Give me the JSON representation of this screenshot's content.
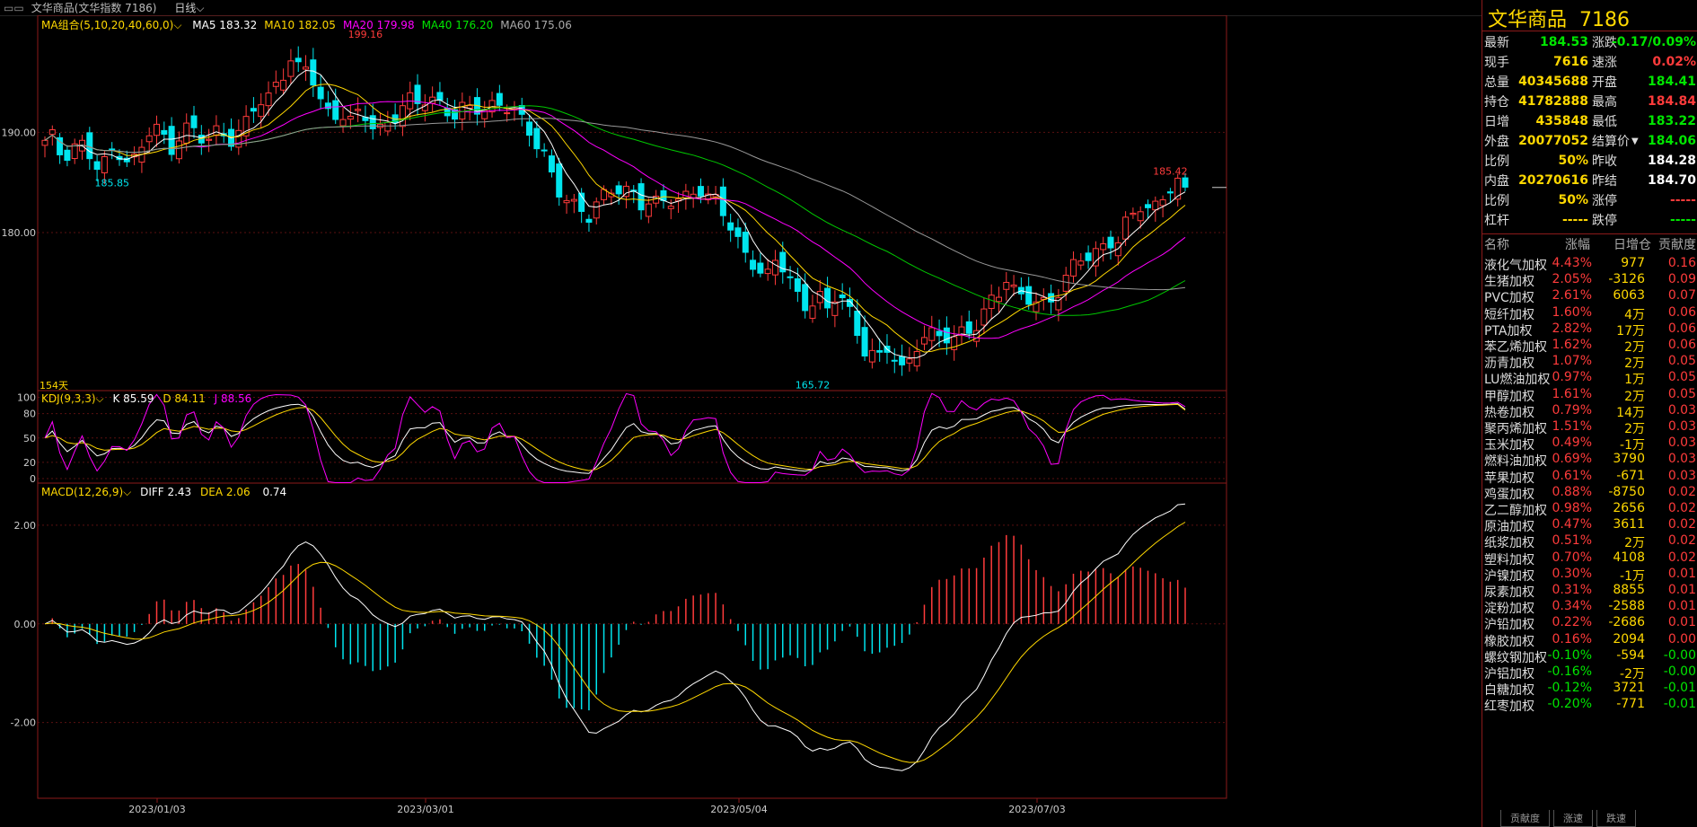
{
  "topbar": {
    "title": "文华商品(文华指数 7186)",
    "period": "日线"
  },
  "main": {
    "ma_title": "MA组合(5,10,20,40,60,0)",
    "ma": [
      {
        "label": "MA5 183.32",
        "color": "#ffffff"
      },
      {
        "label": "MA10 182.05",
        "color": "#ffd800"
      },
      {
        "label": "MA20 179.98",
        "color": "#ff00ff"
      },
      {
        "label": "MA40 176.20",
        "color": "#00e600"
      },
      {
        "label": "MA60 175.06",
        "color": "#aaaaaa"
      }
    ],
    "y_ticks": [
      "190.00",
      "180.00"
    ],
    "max_label": "199.16",
    "min_label": "165.72",
    "low_label": "185.85",
    "last_high_label": "185.42",
    "days": "154天"
  },
  "kdj": {
    "title": "KDJ(9,3,3)",
    "k": "K 85.59",
    "d": "D 84.11",
    "j": "J 88.56",
    "y_ticks": [
      "100",
      "80",
      "50",
      "20",
      "0"
    ]
  },
  "macd": {
    "title": "MACD(12,26,9)",
    "diff": "DIFF 2.43",
    "dea": "DEA 2.06",
    "macd": "0.74",
    "y_ticks": [
      "2.00",
      "0.00",
      "-2.00"
    ]
  },
  "x_axis": [
    "2023/01/03",
    "2023/03/01",
    "2023/05/04",
    "2023/07/03"
  ],
  "panel": {
    "name": "文华商品",
    "code": "7186",
    "quote_left": [
      {
        "label": "最新",
        "value": "184.53",
        "color": "green"
      },
      {
        "label": "现手",
        "value": "7616",
        "color": "yellow"
      },
      {
        "label": "总量",
        "value": "40345688",
        "color": "yellow"
      },
      {
        "label": "持仓",
        "value": "41782888",
        "color": "yellow"
      },
      {
        "label": "日增",
        "value": "435848",
        "color": "yellow"
      },
      {
        "label": "外盘",
        "value": "20077052",
        "color": "yellow"
      },
      {
        "label": "比例",
        "value": "50%",
        "color": "yellow"
      },
      {
        "label": "内盘",
        "value": "20270616",
        "color": "yellow"
      },
      {
        "label": "比例",
        "value": "50%",
        "color": "yellow"
      },
      {
        "label": "杠杆",
        "value": "-----",
        "color": "yellow"
      }
    ],
    "quote_right": [
      {
        "label": "涨跌",
        "value": "-0.17/0.09%",
        "color": "green"
      },
      {
        "label": "速涨",
        "value": "0.02%",
        "color": "red"
      },
      {
        "label": "开盘",
        "value": "184.41",
        "color": "green"
      },
      {
        "label": "最高",
        "value": "184.84",
        "color": "red"
      },
      {
        "label": "最低",
        "value": "183.22",
        "color": "green"
      },
      {
        "label": "结算价",
        "value": "184.06",
        "color": "green"
      },
      {
        "label": "昨收",
        "value": "184.28",
        "color": "white"
      },
      {
        "label": "昨结",
        "value": "184.70",
        "color": "white"
      },
      {
        "label": "涨停",
        "value": "-----",
        "color": "red"
      },
      {
        "label": "跌停",
        "value": "-----",
        "color": "green"
      }
    ],
    "list_headers": [
      "名称",
      "涨幅",
      "日增仓",
      "贡献度"
    ],
    "list": [
      {
        "name": "液化气加权",
        "pct": "4.43%",
        "inc": "977",
        "con": "0.16",
        "dir": "up"
      },
      {
        "name": "生猪加权",
        "pct": "2.05%",
        "inc": "-3126",
        "con": "0.09",
        "dir": "up"
      },
      {
        "name": "PVC加权",
        "pct": "2.61%",
        "inc": "6063",
        "con": "0.07",
        "dir": "up"
      },
      {
        "name": "短纤加权",
        "pct": "1.60%",
        "inc": "4万",
        "con": "0.06",
        "dir": "up"
      },
      {
        "name": "PTA加权",
        "pct": "2.82%",
        "inc": "17万",
        "con": "0.06",
        "dir": "up"
      },
      {
        "name": "苯乙烯加权",
        "pct": "1.62%",
        "inc": "2万",
        "con": "0.06",
        "dir": "up"
      },
      {
        "name": "沥青加权",
        "pct": "1.07%",
        "inc": "2万",
        "con": "0.05",
        "dir": "up"
      },
      {
        "name": "LU燃油加权",
        "pct": "0.97%",
        "inc": "1万",
        "con": "0.05",
        "dir": "up"
      },
      {
        "name": "甲醇加权",
        "pct": "1.61%",
        "inc": "2万",
        "con": "0.05",
        "dir": "up"
      },
      {
        "name": "热卷加权",
        "pct": "0.79%",
        "inc": "14万",
        "con": "0.03",
        "dir": "up"
      },
      {
        "name": "聚丙烯加权",
        "pct": "1.51%",
        "inc": "2万",
        "con": "0.03",
        "dir": "up"
      },
      {
        "name": "玉米加权",
        "pct": "0.49%",
        "inc": "-1万",
        "con": "0.03",
        "dir": "up"
      },
      {
        "name": "燃料油加权",
        "pct": "0.69%",
        "inc": "3790",
        "con": "0.03",
        "dir": "up"
      },
      {
        "name": "苹果加权",
        "pct": "0.61%",
        "inc": "-671",
        "con": "0.03",
        "dir": "up"
      },
      {
        "name": "鸡蛋加权",
        "pct": "0.88%",
        "inc": "-8750",
        "con": "0.02",
        "dir": "up"
      },
      {
        "name": "乙二醇加权",
        "pct": "0.98%",
        "inc": "2656",
        "con": "0.02",
        "dir": "up"
      },
      {
        "name": "原油加权",
        "pct": "0.47%",
        "inc": "3611",
        "con": "0.02",
        "dir": "up"
      },
      {
        "name": "纸浆加权",
        "pct": "0.51%",
        "inc": "2万",
        "con": "0.02",
        "dir": "up"
      },
      {
        "name": "塑料加权",
        "pct": "0.70%",
        "inc": "4108",
        "con": "0.02",
        "dir": "up"
      },
      {
        "name": "沪镍加权",
        "pct": "0.30%",
        "inc": "-1万",
        "con": "0.01",
        "dir": "up"
      },
      {
        "name": "尿素加权",
        "pct": "0.31%",
        "inc": "8855",
        "con": "0.01",
        "dir": "up"
      },
      {
        "name": "淀粉加权",
        "pct": "0.34%",
        "inc": "-2588",
        "con": "0.01",
        "dir": "up"
      },
      {
        "name": "沪铅加权",
        "pct": "0.22%",
        "inc": "-2686",
        "con": "0.01",
        "dir": "up"
      },
      {
        "name": "橡胶加权",
        "pct": "0.16%",
        "inc": "2094",
        "con": "0.00",
        "dir": "up"
      },
      {
        "name": "螺纹钢加权",
        "pct": "-0.10%",
        "inc": "-594",
        "con": "-0.00",
        "dir": "down"
      },
      {
        "name": "沪铝加权",
        "pct": "-0.16%",
        "inc": "-2万",
        "con": "-0.00",
        "dir": "down"
      },
      {
        "name": "白糖加权",
        "pct": "-0.12%",
        "inc": "3721",
        "con": "-0.01",
        "dir": "down"
      },
      {
        "name": "红枣加权",
        "pct": "-0.20%",
        "inc": "-771",
        "con": "-0.01",
        "dir": "down"
      }
    ],
    "tabs": [
      "贡献度",
      "涨速",
      "跌速"
    ]
  },
  "chart_data": {
    "type": "candlestick",
    "title": "文华商品(文华指数 7186)",
    "period": "日线",
    "y_ticks": [
      190.0,
      180.0
    ],
    "ylim": [
      164.5,
      201.5
    ],
    "x_tick_labels": [
      "2023/01/03",
      "2023/03/01",
      "2023/05/04",
      "2023/07/03"
    ],
    "close_path": [
      188.8,
      189.5,
      187.5,
      188.5,
      189.3,
      188.0,
      186.2,
      186.8,
      188.3,
      188.2,
      187.1,
      187.5,
      189.6,
      190.5,
      189.4,
      188.4,
      190.4,
      190.6,
      189.2,
      188.9,
      190.2,
      190.0,
      189.5,
      190.3,
      191.0,
      192.9,
      193.2,
      194.8,
      196.0,
      197.6,
      195.8,
      196.1,
      194.2,
      192.3,
      191.8,
      191.9,
      190.9,
      191.6,
      191.3,
      190.4,
      191.0,
      191.4,
      192.4,
      193.0,
      192.7,
      193.8,
      193.5,
      192.4,
      191.3,
      192.1,
      192.2,
      192.6,
      192.8,
      193.0,
      192.4,
      191.9,
      191.1,
      190.1,
      189.0,
      187.6,
      184.2,
      183.2,
      182.6,
      182.2,
      182.0,
      183.6,
      183.8,
      183.9,
      184.1,
      184.0,
      183.1,
      183.5,
      183.0,
      182.6,
      183.0,
      183.4,
      184.3,
      184.6,
      183.5,
      182.9,
      181.2,
      179.9,
      178.5,
      177.5,
      176.1,
      175.4,
      177.2,
      176.2,
      175.0,
      172.8,
      173.0,
      173.5,
      171.7,
      173.8,
      173.9,
      171.4,
      168.4,
      168.0,
      167.0,
      168.2,
      167.8,
      166.4,
      167.9,
      169.4,
      169.6,
      169.4,
      169.8,
      170.0,
      170.4,
      169.9,
      171.0,
      172.9,
      174.0,
      175.8,
      174.3,
      173.4,
      172.9,
      172.6,
      173.1,
      174.3,
      175.8,
      176.9,
      177.3,
      177.2,
      178.4,
      179.5,
      179.2,
      180.9,
      181.7,
      182.5,
      182.0,
      183.6,
      184.6,
      185.0,
      184.53
    ],
    "candles_count": 154,
    "highlights": {
      "max": 199.16,
      "min": 165.72,
      "first_low": 185.85,
      "last_high": 185.42
    },
    "ma": {
      "MA5": 183.32,
      "MA10": 182.05,
      "MA20": 179.98,
      "MA40": 176.2,
      "MA60": 175.06
    },
    "kdj": {
      "K": 85.59,
      "D": 84.11,
      "J": 88.56,
      "ylim": [
        0,
        100
      ]
    },
    "macd": {
      "DIFF": 2.43,
      "DEA": 2.06,
      "MACD": 0.74,
      "ylim": [
        -3.5,
        2.8
      ]
    }
  }
}
